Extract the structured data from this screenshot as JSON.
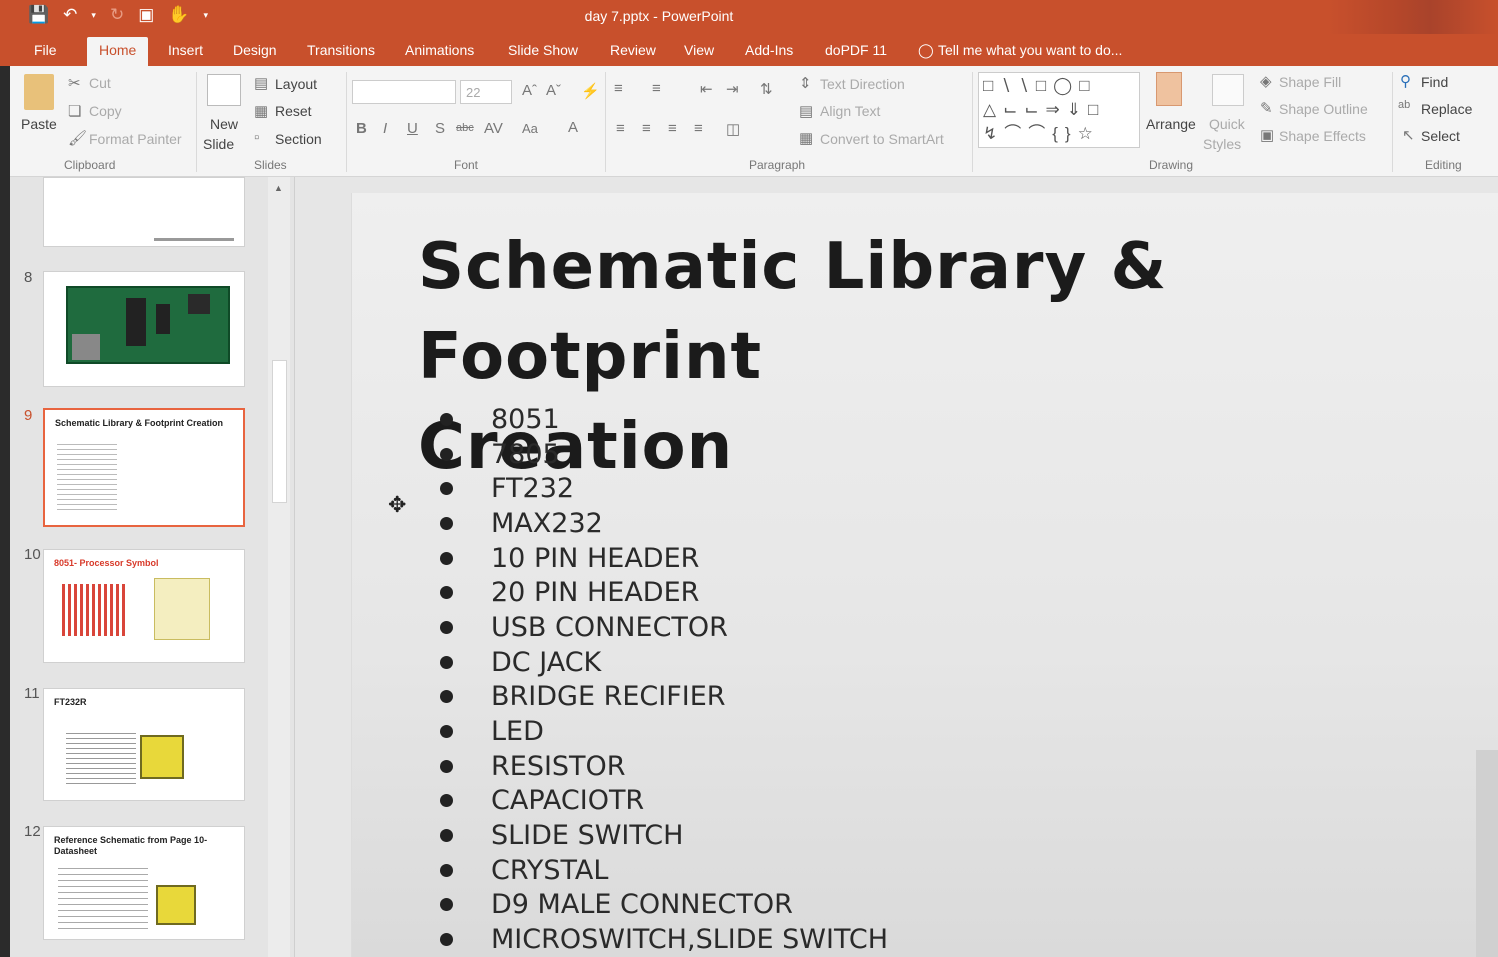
{
  "window": {
    "title": "day 7.pptx - PowerPoint"
  },
  "quick_access": [
    "save-icon",
    "undo-icon",
    "redo-icon",
    "present-icon",
    "touch-icon"
  ],
  "tabs": [
    "File",
    "Home",
    "Insert",
    "Design",
    "Transitions",
    "Animations",
    "Slide Show",
    "Review",
    "View",
    "Add-Ins",
    "doPDF 11",
    "Tell me what you want to do..."
  ],
  "ribbon": {
    "clipboard": {
      "paste": "Paste",
      "cut": "Cut",
      "copy": "Copy",
      "format_painter": "Format Painter",
      "label": "Clipboard"
    },
    "slides": {
      "new_slide_1": "New",
      "new_slide_2": "Slide",
      "layout": "Layout",
      "reset": "Reset",
      "section": "Section",
      "label": "Slides"
    },
    "font": {
      "size": "22",
      "label": "Font"
    },
    "paragraph": {
      "text_direction": "Text Direction",
      "align_text": "Align Text",
      "convert_smartart": "Convert to SmartArt",
      "label": "Paragraph"
    },
    "drawing": {
      "arrange": "Arrange",
      "quick_1": "Quick",
      "quick_2": "Styles",
      "shape_fill": "Shape Fill",
      "shape_outline": "Shape Outline",
      "shape_effects": "Shape Effects",
      "label": "Drawing"
    },
    "editing": {
      "find": "Find",
      "replace": "Replace",
      "select": "Select",
      "label": "Editing"
    }
  },
  "thumbnails": [
    {
      "num": "8"
    },
    {
      "num": "9",
      "title": "Schematic Library & Footprint Creation"
    },
    {
      "num": "10",
      "title": "8051- Processor Symbol"
    },
    {
      "num": "11",
      "title": "FT232R"
    },
    {
      "num": "12",
      "title": "Reference Schematic from Page 10- Datasheet"
    }
  ],
  "slide": {
    "title_line1": "Schematic Library & Footprint",
    "title_line2": "Creation",
    "bullets": [
      "8051",
      "7805",
      "FT232",
      "MAX232",
      "10 PIN HEADER",
      "20 PIN HEADER",
      "USB CONNECTOR",
      "DC JACK",
      "BRIDGE RECIFIER",
      "LED",
      "RESISTOR",
      "CAPACIOTR",
      "SLIDE SWITCH",
      "CRYSTAL",
      "D9 MALE CONNECTOR",
      "MICROSWITCH,SLIDE SWITCH"
    ]
  },
  "colors": {
    "accent": "#c8502c",
    "selected_thumb": "#e8643f"
  }
}
